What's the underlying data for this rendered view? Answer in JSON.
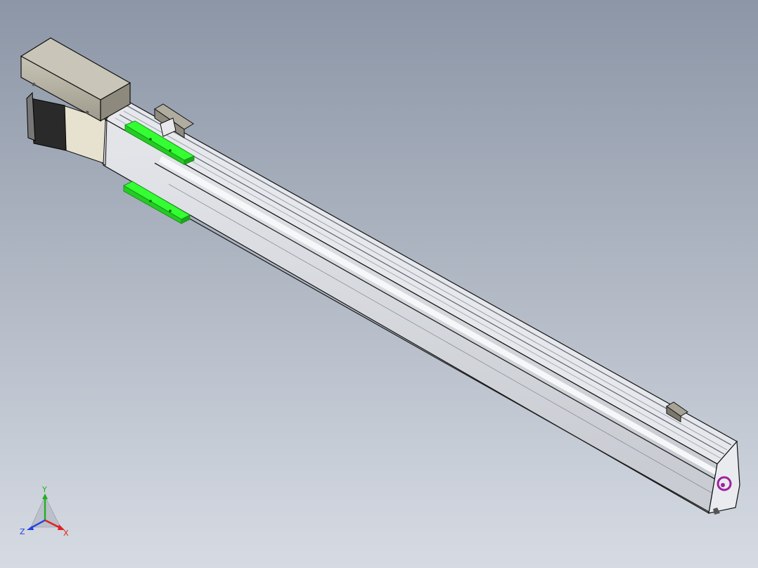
{
  "viewport": {
    "background_top": "#8c96a6",
    "background_bottom": "#d6dbe3"
  },
  "model": {
    "body_color": "#d9dce1",
    "edge_color": "#111111",
    "highlight_color": "#f2f4f7",
    "slot_color": "#b7bcc6",
    "motor_body_color": "#2a2a2a",
    "motor_housing_color": "#b9b5a8",
    "coupling_color": "#e6e2cf",
    "sensor_bracket_color": "#33ff33",
    "sensor_bracket_edge": "#1d8f1d",
    "logo_color": "#a020a0"
  },
  "triad": {
    "x_label": "X",
    "y_label": "Y",
    "z_label": "Z",
    "x_color": "#e02020",
    "y_color": "#20b020",
    "z_color": "#2040e0"
  }
}
